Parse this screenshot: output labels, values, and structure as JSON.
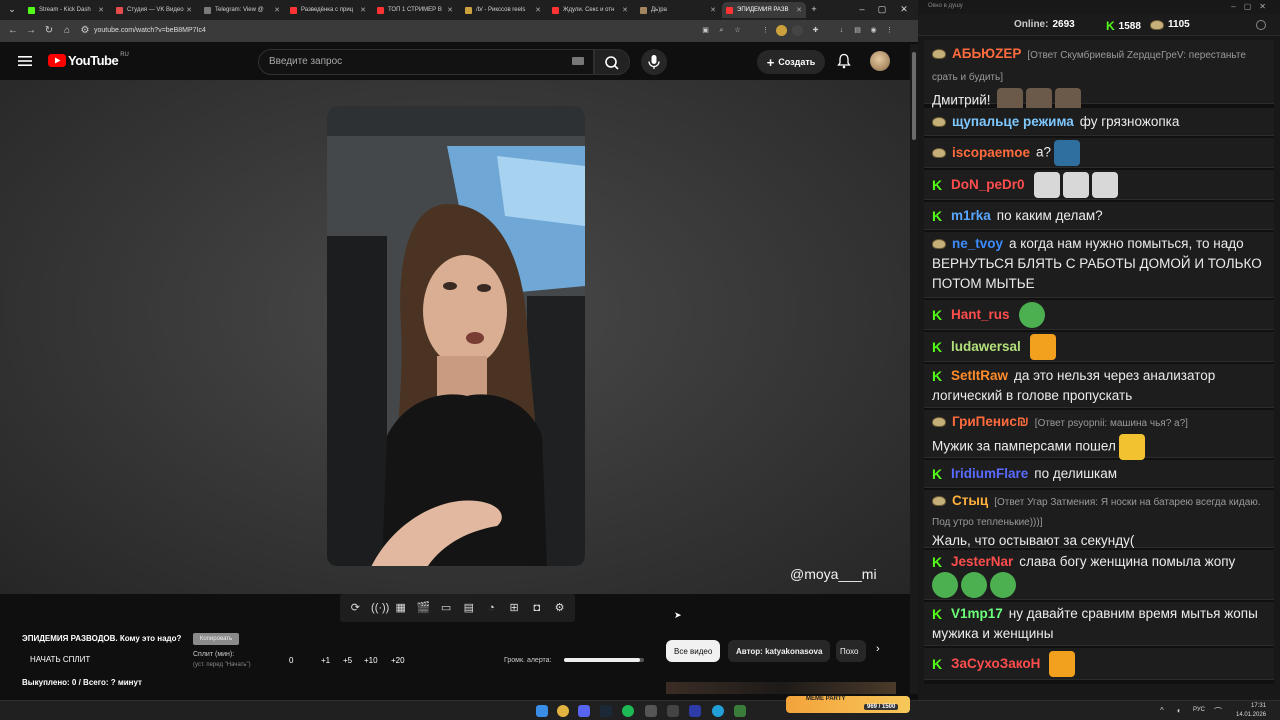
{
  "browser": {
    "tabs": [
      {
        "label": "Stream - Kick Dash",
        "color": "#53fc18",
        "active": false
      },
      {
        "label": "Студия — VK Видео",
        "color": "#e54b4b",
        "active": false
      },
      {
        "label": "Telegram: View @",
        "color": "#7a7a7a",
        "active": false
      },
      {
        "label": "Разведёнка с приц",
        "color": "#ff3333",
        "active": false
      },
      {
        "label": "ТОП 1 СТРИМЕР В",
        "color": "#ff3333",
        "active": false
      },
      {
        "label": "/b/ - Рикссов reels",
        "color": "#caa13c",
        "active": false
      },
      {
        "label": "Ждули. Секс и отн",
        "color": "#ff3333",
        "active": false
      },
      {
        "label": "Дь)ра",
        "color": "#a2845e",
        "active": false
      },
      {
        "label": "ЭПИДЕМИЯ РАЗВ",
        "color": "#ff3333",
        "active": true
      }
    ],
    "url": "youtube.com/watch?v=beB8MP7Ic4"
  },
  "youtube": {
    "logo_text": "YouTube",
    "logo_region": "RU",
    "search_placeholder": "Введите запрос",
    "create_label": "Создать"
  },
  "video": {
    "watermark": "@moya___mi"
  },
  "split": {
    "title": "ЭПИДЕМИЯ РАЗВОДОВ. Кому это надо?",
    "copy_label": "Копировать",
    "start_label": "НАЧАТЬ СПЛИТ",
    "minutes_label": "Сплит (мин):",
    "minutes_hint": "(уст. перед \"Начать\")",
    "value": "0",
    "inc1": "+1",
    "inc5": "+5",
    "inc10": "+10",
    "inc20": "+20",
    "alert_volume_label": "Громк. алерта:",
    "alert_volume": 0.95,
    "bought_line": "Выкуплено: 0 / Всего: ? минут"
  },
  "chips": {
    "all": "Все видео",
    "author": "Автор: katyakonasova",
    "similar": "Похо"
  },
  "chat": {
    "window_title": "Окно в душу",
    "online_label": "Online:",
    "online_count": "2693",
    "kick_count": "1588",
    "frog_count": "1105",
    "messages": [
      {
        "user": "АБЬЮZЕР",
        "color": "#ff6b3d",
        "badge": "frog",
        "reply": "[Ответ Скумбриевый ZердцеГреV: перестаньте срать и будить]",
        "text": "Дмитрий!"
      },
      {
        "user": "щупальце режима",
        "color": "#7ec8ff",
        "badge": "frog",
        "reply": "",
        "text": "фу грязножопка"
      },
      {
        "user": "iscopaemoe",
        "color": "#ff6b3d",
        "badge": "frog",
        "reply": "",
        "text": "а?"
      },
      {
        "user": "DoN_peDr0",
        "color": "#ff4d4d",
        "badge": "kick",
        "reply": "",
        "text": ""
      },
      {
        "user": "m1rka",
        "color": "#5aa7ff",
        "badge": "kick",
        "reply": "",
        "text": "по каким делам?"
      },
      {
        "user": "ne_tvoy",
        "color": "#3b8dff",
        "badge": "frog",
        "reply": "",
        "text": "а когда нам нужно помыться, то надо ВЕРНУТЬСЯ БЛЯТЬ С РАБОТЫ ДОМОЙ И ТОЛЬКО ПОТОМ МЫТЬЕ"
      },
      {
        "user": "Hant_rus",
        "color": "#ff4d4d",
        "badge": "kick",
        "reply": "",
        "text": ""
      },
      {
        "user": "ludawersal",
        "color": "#b3e07a",
        "badge": "kick",
        "reply": "",
        "text": ""
      },
      {
        "user": "SetItRaw",
        "color": "#ff8c2a",
        "badge": "kick",
        "reply": "",
        "text": "да это нельзя через анализатор логический в голове пропускать"
      },
      {
        "user": "ГриПенис₪",
        "color": "#ff6b3d",
        "badge": "frog",
        "reply": "[Ответ psyopnii: машина чья? а?]",
        "text": "Мужик за памперсами пошел"
      },
      {
        "user": "IridiumFlare",
        "color": "#5a6bff",
        "badge": "kick",
        "reply": "",
        "text": "по делишкам"
      },
      {
        "user": "Стыц",
        "color": "#ffb13d",
        "badge": "frog",
        "reply": "[Ответ Угар Затмения: Я носки на батарею всегда кидаю. Под утро тепленькие)))]",
        "text": "Жаль, что остывают за секунду("
      },
      {
        "user": "JesterNar",
        "color": "#ff4d4d",
        "badge": "kick",
        "reply": "",
        "text": "слава богу женщина помыла жопу"
      },
      {
        "user": "V1mp17",
        "color": "#6bff7a",
        "badge": "kick",
        "reply": "",
        "text": "ну давайте сравним время мытья жопы мужика и женщины"
      },
      {
        "user": "ЗаСухоЗакоН",
        "color": "#ff4d4d",
        "badge": "kick",
        "reply": "",
        "text": ""
      }
    ]
  },
  "taskbar": {
    "lang": "РУС",
    "time": "17:31",
    "date": "14.01.2026",
    "meme_label": "MEME PARTY",
    "meme_progress": "969 / 1500"
  },
  "colors": {
    "accent_red": "#ff0000",
    "kick_green": "#53fc18"
  }
}
